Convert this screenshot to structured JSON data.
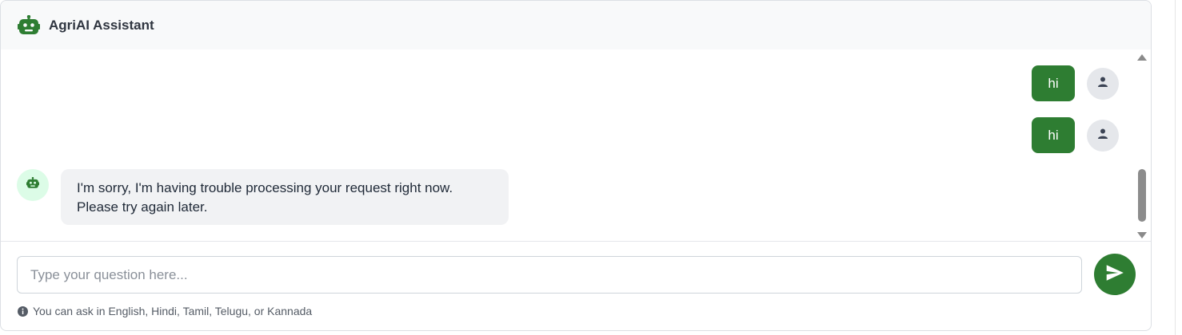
{
  "header": {
    "title": "AgriAI Assistant",
    "icon": "robot-icon"
  },
  "messages": [
    {
      "role": "user",
      "text": "hi"
    },
    {
      "role": "user",
      "text": "hi"
    },
    {
      "role": "bot",
      "text": "I'm sorry, I'm having trouble processing your request right now. Please try again later."
    }
  ],
  "composer": {
    "placeholder": "Type your question here...",
    "value": "",
    "send_icon": "send-icon"
  },
  "hint": {
    "text": "You can ask in English, Hindi, Tamil, Telugu, or Kannada",
    "icon": "info-icon"
  },
  "colors": {
    "accent": "#2e7d32",
    "header_bg": "#f8f9fa",
    "bot_bubble": "#f1f2f4",
    "bot_avatar_bg": "#dcfce7"
  }
}
